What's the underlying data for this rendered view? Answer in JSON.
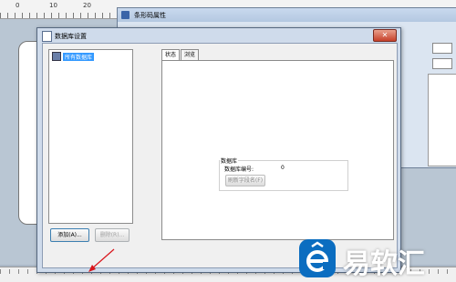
{
  "ruler": {
    "ticks": [
      "0",
      "10",
      "20"
    ]
  },
  "barcode_window": {
    "title": "条形码属性"
  },
  "dialog": {
    "title": "数据库设置",
    "close_glyph": "✕",
    "tree": {
      "root_label": "所有数据库"
    },
    "buttons": {
      "add": "添加(A)...",
      "delete": "删除(R)..."
    },
    "tabs": [
      {
        "label": "状态",
        "active": true
      },
      {
        "label": "浏览",
        "active": false
      }
    ],
    "db_group": {
      "title": "数据库",
      "number_label": "数据库编号:",
      "number_value": "0",
      "refresh_button": "刷新字段名(F)"
    }
  },
  "watermark": {
    "text": "易软汇"
  },
  "colors": {
    "arrow": "#d9151b",
    "watermark_badge": "#0b6dc0"
  }
}
